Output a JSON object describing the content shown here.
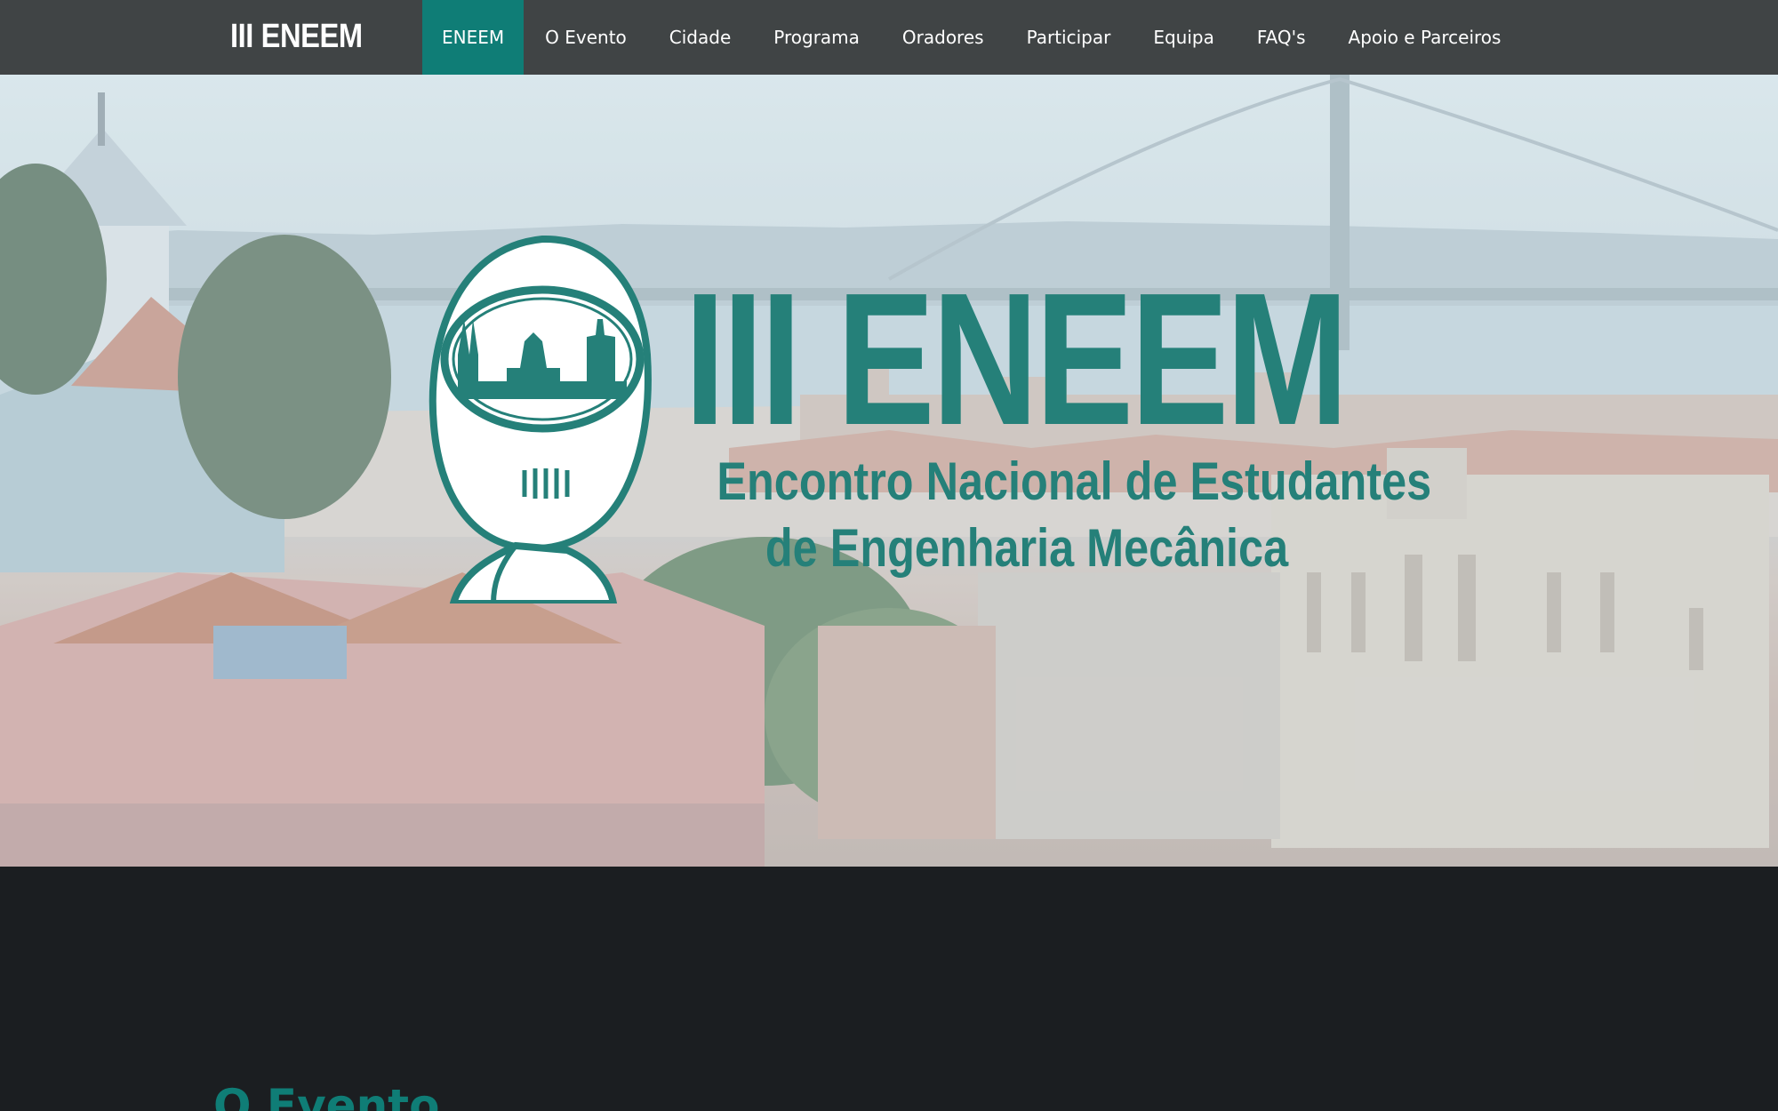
{
  "navbar": {
    "brand": "III ENEEM",
    "items": [
      {
        "label": "ENEEM",
        "active": true
      },
      {
        "label": "O Evento"
      },
      {
        "label": "Cidade"
      },
      {
        "label": "Programa"
      },
      {
        "label": "Oradores"
      },
      {
        "label": "Participar"
      },
      {
        "label": "Equipa"
      },
      {
        "label": "FAQ's"
      },
      {
        "label": "Apoio e Parceiros"
      }
    ]
  },
  "hero": {
    "logo_title": "III ENEEM",
    "logo_subtitle_line1": "Encontro Nacional de Estudantes",
    "logo_subtitle_line2": "de Engenharia Mecânica"
  },
  "section": {
    "title": "O Evento"
  },
  "colors": {
    "accent": "#0f7d76",
    "logo_teal": "#258079",
    "navbar_bg": "#404445",
    "page_bg": "#1b1e21"
  }
}
